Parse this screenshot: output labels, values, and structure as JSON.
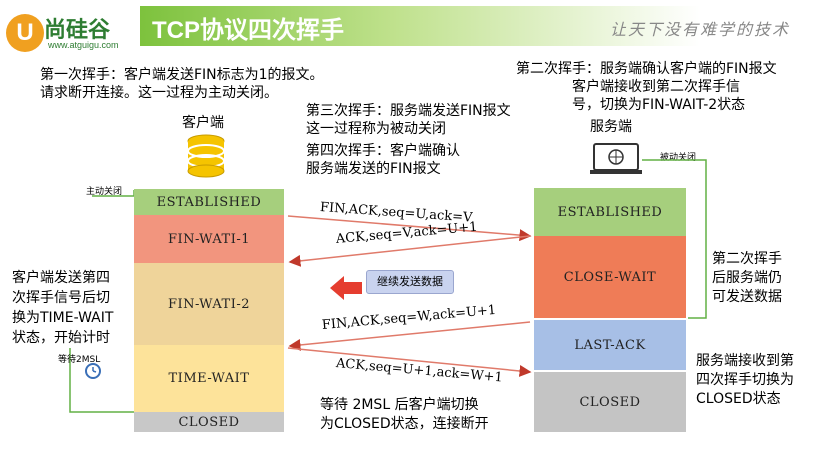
{
  "header": {
    "logo_text": "U",
    "brand_name": "尚硅谷",
    "brand_url": "www.atguigu.com",
    "title": "TCP协议四次挥手",
    "slogan": "让天下没有难学的技术"
  },
  "notes": {
    "first_wave": [
      "第一次挥手：客户端发送FIN标志为1的报文。",
      "请求断开连接。这一过程为主动关闭。"
    ],
    "second_wave": [
      "第二次挥手：服务端确认客户端的FIN报文",
      "客户端接收到第二次挥手信",
      "号，切换为FIN-WAIT-2状态"
    ],
    "third_wave": [
      "第三次挥手：服务端发送FIN报文",
      "这一过程称为被动关闭"
    ],
    "fourth_wave": [
      "第四次挥手：客户端确认",
      "服务端发送的FIN报文"
    ],
    "client_time_wait": [
      "客户端发送第四",
      "次挥手信号后切",
      "换为TIME-WAIT",
      "状态，开始计时"
    ],
    "server_after_second": [
      "第二次挥手",
      "后服务端仍",
      "可发送数据"
    ],
    "server_closed": [
      "服务端接收到第",
      "四次挥手切换为",
      "CLOSED状态"
    ],
    "wait_2msl": [
      "等待 2MSL 后客户端切换",
      "为CLOSED状态，连接断开"
    ]
  },
  "client": {
    "label": "客户端",
    "active_close": "主动关闭",
    "wait_label": "等待2MSL",
    "states": [
      "ESTABLISHED",
      "FIN-WATI-1",
      "FIN-WATI-2",
      "TIME-WAIT",
      "CLOSED"
    ]
  },
  "server": {
    "label": "服务端",
    "passive_close": "被动关闭",
    "states": [
      "ESTABLISHED",
      "CLOSE-WAIT",
      "LAST-ACK",
      "CLOSED"
    ]
  },
  "messages": {
    "m1": "FIN,ACK,seq=U,ack=V",
    "m2": "ACK,seq=V,ack=U+1",
    "m3": "FIN,ACK,seq=W,ack=U+1",
    "m4": "ACK,seq=U+1,ack=W+1",
    "continue_label": "继续发送数据"
  },
  "colors": {
    "title_green": "#7dc23d",
    "established": "#a6cf7d",
    "fin_wait_1": "#f2957e",
    "fin_wait_2": "#efd49a",
    "time_wait": "#fde39a",
    "closed_client": "#c8c8c8",
    "close_wait": "#ef7c57",
    "last_ack": "#a7bfe6",
    "closed_server": "#c4c4c4",
    "arrow_red": "#e53d2f",
    "line_green": "#62b045"
  }
}
